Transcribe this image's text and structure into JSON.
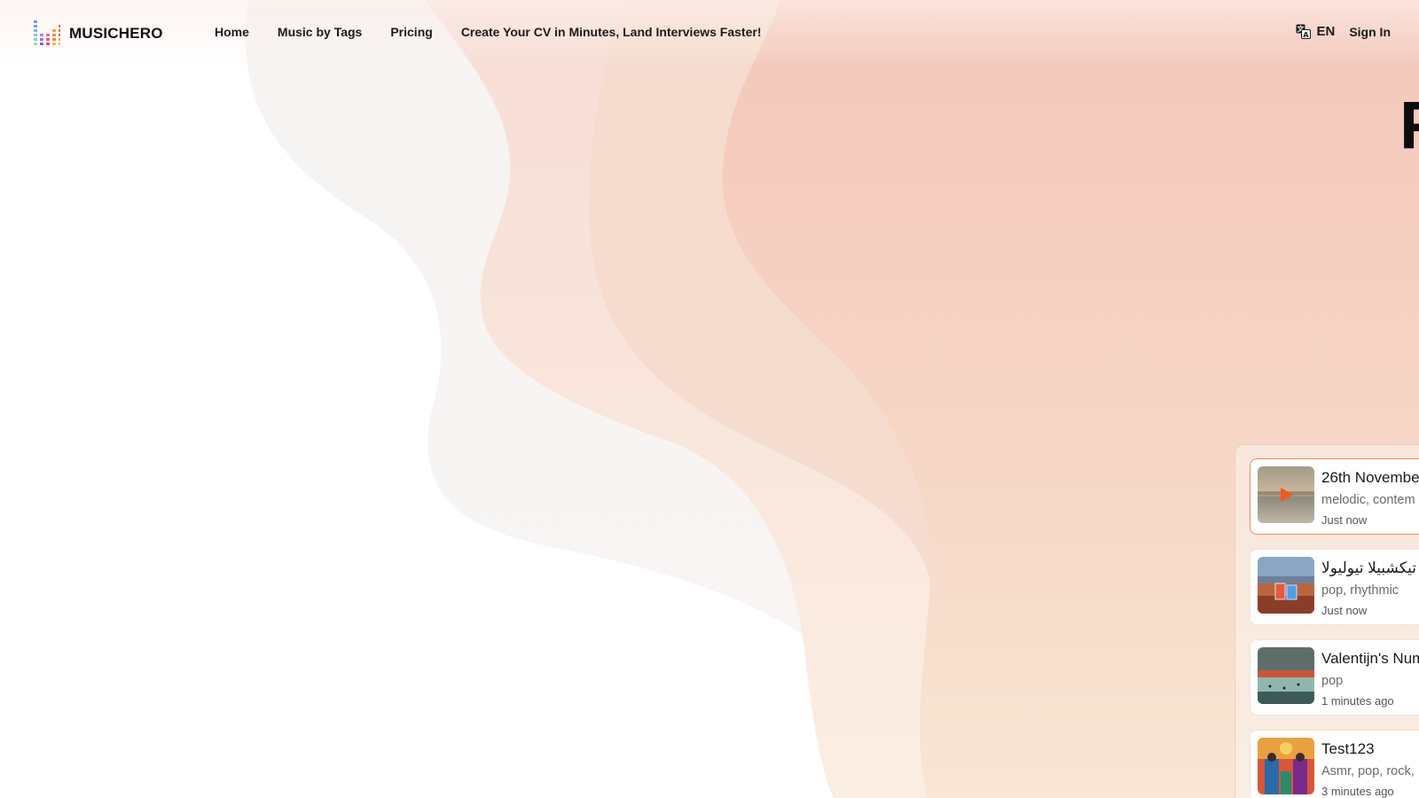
{
  "brand": {
    "name": "MUSICHERO",
    "logo_icon": "equalizer-bars-logo"
  },
  "nav": {
    "items": [
      {
        "label": "Home"
      },
      {
        "label": "Music by Tags"
      },
      {
        "label": "Pricing"
      },
      {
        "label": "Create Your CV in Minutes, Land Interviews Faster!"
      }
    ]
  },
  "header_right": {
    "language": "EN",
    "language_icon": "translate-icon",
    "sign_in": "Sign In"
  },
  "hero": {
    "title_visible": "F"
  },
  "songs": [
    {
      "title": "26th Novembe",
      "tags": "melodic, contem",
      "time": "Just now",
      "active": true,
      "play_icon": "play-icon"
    },
    {
      "title": "تيكشبيلا تيوليولا",
      "tags": "pop, rhythmic",
      "time": "Just now",
      "active": false
    },
    {
      "title": "Valentijn's Num",
      "tags": "pop",
      "time": "1 minutes ago",
      "active": false
    },
    {
      "title": "Test123",
      "tags": "Asmr, pop, rock,",
      "time": "3 minutes ago",
      "active": false
    }
  ],
  "colors": {
    "accent": "#f08a5a",
    "play": "#f05a1a",
    "background_warm": "#f5c4b6"
  }
}
